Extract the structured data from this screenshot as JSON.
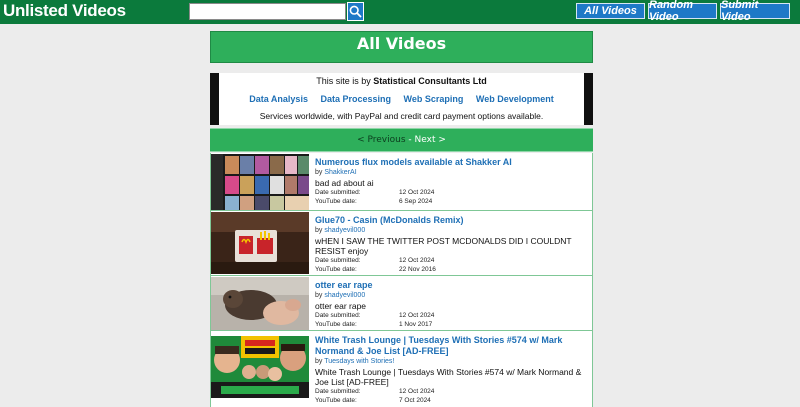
{
  "header": {
    "logo": "Unlisted Videos",
    "search": {
      "value": "",
      "placeholder": ""
    },
    "nav": [
      {
        "label": "All Videos"
      },
      {
        "label": "Random Video"
      },
      {
        "label": "Submit Video"
      }
    ]
  },
  "page_title": "All Videos",
  "ad": {
    "line1_prefix": "This site is by ",
    "line1_company": "Statistical Consultants Ltd",
    "links": [
      "Data Analysis",
      "Data Processing",
      "Web Scraping",
      "Web Development"
    ],
    "line3": "Services worldwide, with PayPal and credit card payment options available."
  },
  "pager": {
    "previous": "< Previous",
    "separator": " - ",
    "next": "Next >"
  },
  "labels": {
    "by": "by ",
    "date_submitted": "Date submitted:",
    "youtube_date": "YouTube date:"
  },
  "videos": [
    {
      "title": "Numerous flux models available at Shakker AI",
      "channel": "ShakkerAI",
      "description": "bad ad about ai",
      "date_submitted": "12 Oct 2024",
      "youtube_date": "6 Sep 2024"
    },
    {
      "title": "Glue70 - Casin (McDonalds Remix)",
      "channel": "shadyevil000",
      "description": "wHEN I SAW THE TWITTER POST MCDONALDS DID I COULDNT RESIST enjoy",
      "date_submitted": "12 Oct 2024",
      "youtube_date": "22 Nov 2016"
    },
    {
      "title": "otter ear rape",
      "channel": "shadyevil000",
      "description": "otter ear rape",
      "date_submitted": "12 Oct 2024",
      "youtube_date": "1 Nov 2017"
    },
    {
      "title": "White Trash Lounge | Tuesdays With Stories #574 w/ Mark Normand & Joe List [AD-FREE]",
      "channel": "Tuesdays with Stories!",
      "description": "White Trash Lounge | Tuesdays With Stories #574 w/ Mark Normand & Joe List [AD-FREE]",
      "date_submitted": "12 Oct 2024",
      "youtube_date": "7 Oct 2024"
    }
  ]
}
